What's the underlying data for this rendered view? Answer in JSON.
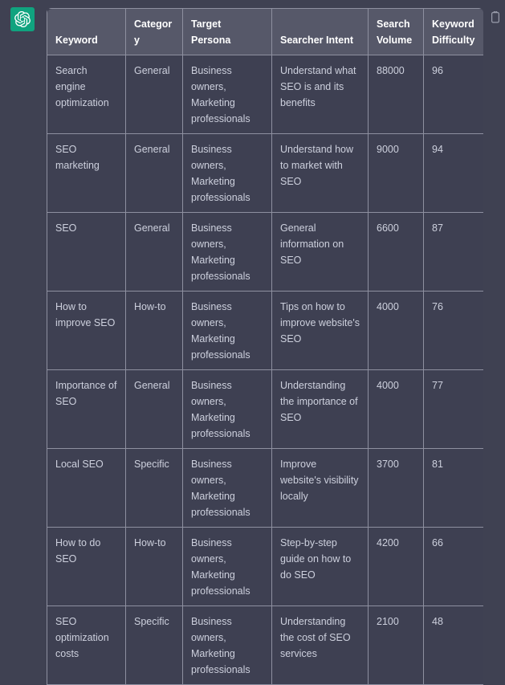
{
  "assistant": {
    "avatar_icon": "openai-logo-icon",
    "avatar_color": "#10a37f"
  },
  "actions": {
    "copy_icon": "copy-clipboard-icon",
    "copy_label": "Copy"
  },
  "table": {
    "headers": [
      "Keyword",
      "Category",
      "Target Persona",
      "Searcher Intent",
      "Search Volume",
      "Keyword Difficulty"
    ],
    "rows": [
      {
        "keyword": "Search engine optimization",
        "category": "General",
        "persona": "Business owners, Marketing professionals",
        "intent": "Understand what SEO is and its benefits",
        "volume": "88000",
        "difficulty": "96"
      },
      {
        "keyword": "SEO marketing",
        "category": "General",
        "persona": "Business owners, Marketing professionals",
        "intent": "Understand how to market with SEO",
        "volume": "9000",
        "difficulty": "94"
      },
      {
        "keyword": "SEO",
        "category": "General",
        "persona": "Business owners, Marketing professionals",
        "intent": "General information on SEO",
        "volume": "6600",
        "difficulty": "87"
      },
      {
        "keyword": "How to improve SEO",
        "category": "How-to",
        "persona": "Business owners, Marketing professionals",
        "intent": "Tips on how to improve website's SEO",
        "volume": "4000",
        "difficulty": "76"
      },
      {
        "keyword": "Importance of SEO",
        "category": "General",
        "persona": "Business owners, Marketing professionals",
        "intent": "Understanding the importance of SEO",
        "volume": "4000",
        "difficulty": "77"
      },
      {
        "keyword": "Local SEO",
        "category": "Specific",
        "persona": "Business owners, Marketing professionals",
        "intent": "Improve website's visibility locally",
        "volume": "3700",
        "difficulty": "81"
      },
      {
        "keyword": "How to do SEO",
        "category": "How-to",
        "persona": "Business owners, Marketing professionals",
        "intent": "Step-by-step guide on how to do SEO",
        "volume": "4200",
        "difficulty": "66"
      },
      {
        "keyword": "SEO optimization costs",
        "category": "Specific",
        "persona": "Business owners, Marketing professionals",
        "intent": "Understanding the cost of SEO services",
        "volume": "2100",
        "difficulty": "48"
      }
    ]
  },
  "colors": {
    "page_background": "#3f4152",
    "header_background": "#565869",
    "cell_background": "#3e4052",
    "grid_line": "#8e90a0",
    "header_text": "#ffffff",
    "cell_text": "#cdd0dd",
    "accent": "#10a37f"
  }
}
